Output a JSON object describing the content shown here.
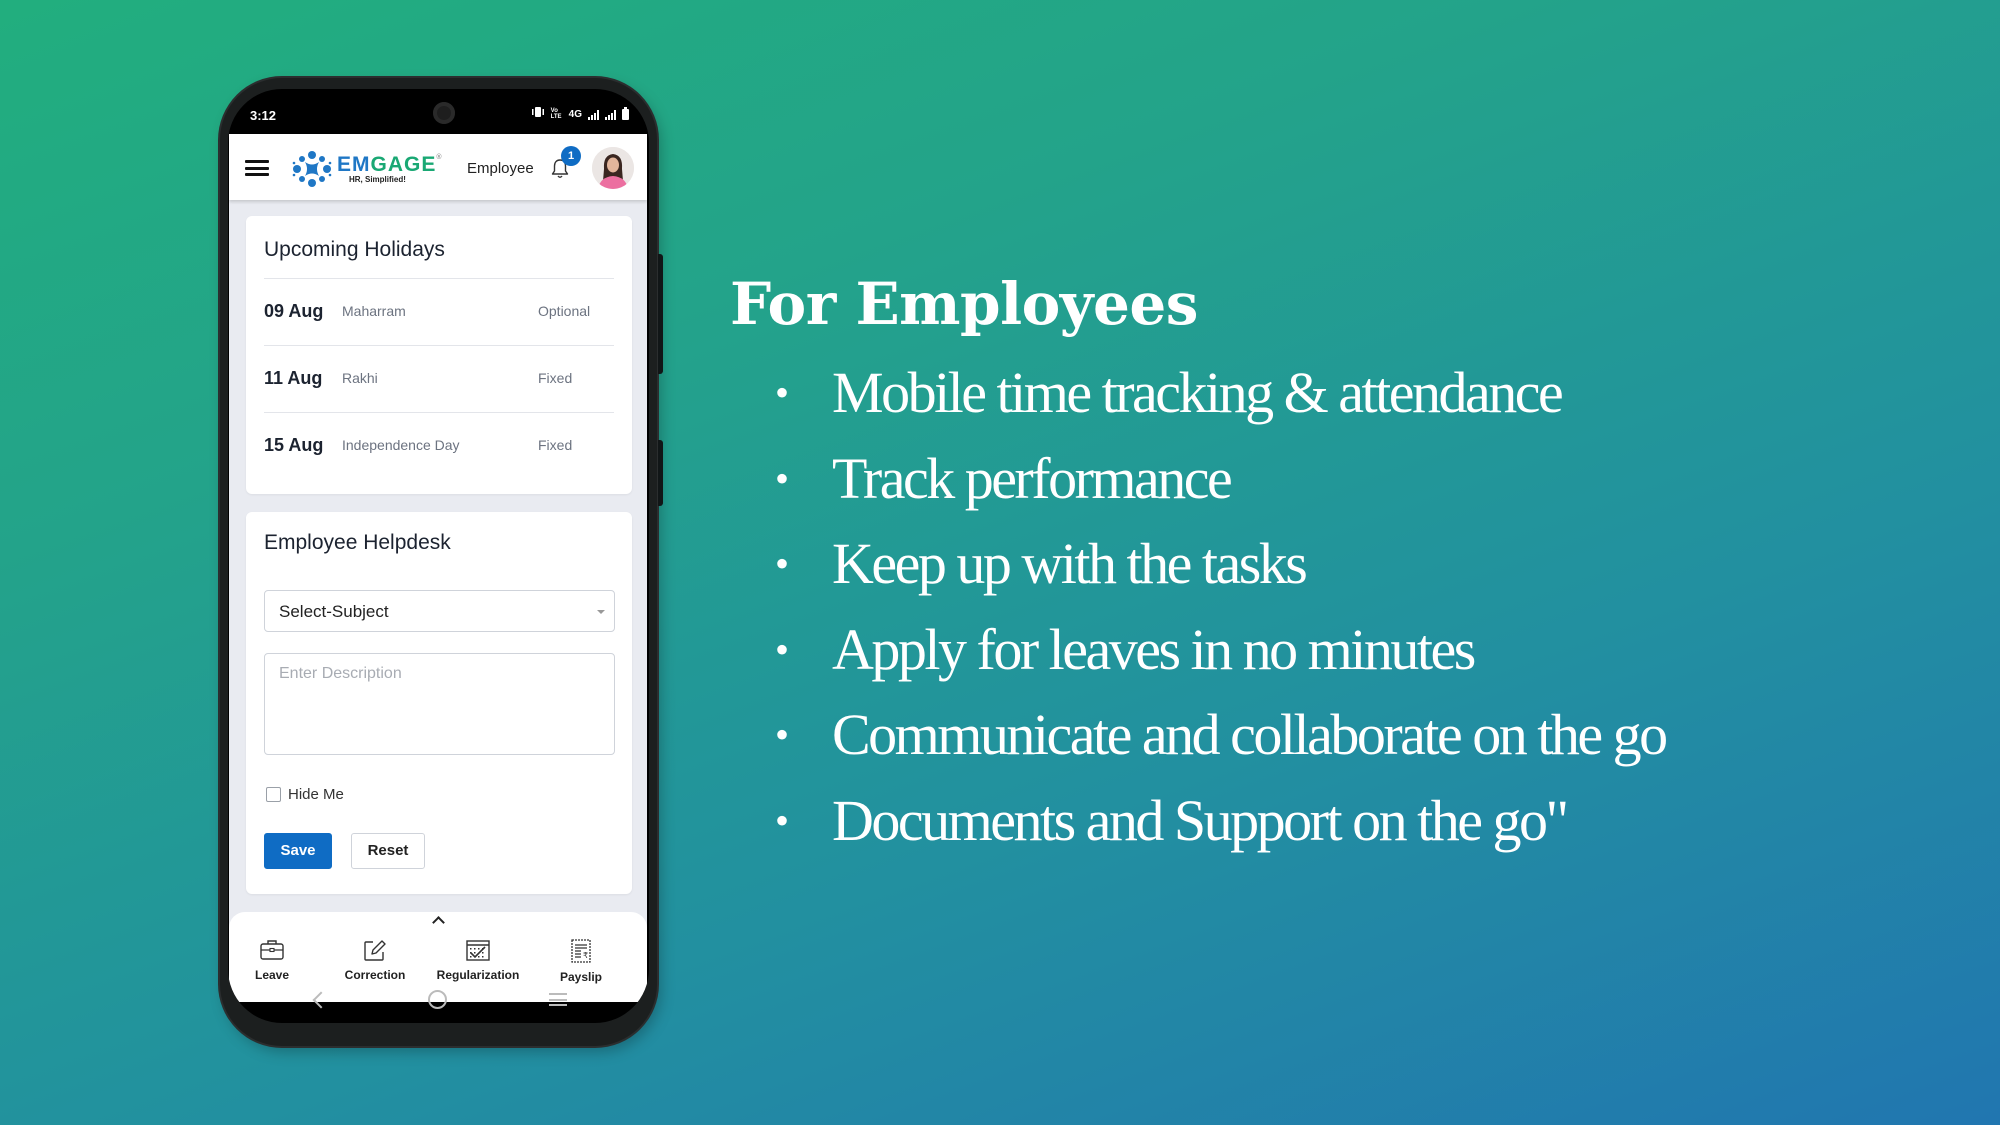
{
  "status_bar": {
    "time": "3:12",
    "network_label": "4G",
    "volte_label": "VoLTE"
  },
  "app_header": {
    "menu_icon": "hamburger-icon",
    "logo": {
      "word_part1": "EM",
      "word_part2": "GAGE",
      "registered": "®",
      "tagline": "HR, Simplified!"
    },
    "role": "Employee",
    "notifications_count": "1",
    "avatar_alt": "user-avatar"
  },
  "holidays": {
    "title": "Upcoming Holidays",
    "items": [
      {
        "date": "09 Aug",
        "name": "Maharram",
        "type": "Optional"
      },
      {
        "date": "11 Aug",
        "name": "Rakhi",
        "type": "Fixed"
      },
      {
        "date": "15 Aug",
        "name": "Independence Day",
        "type": "Fixed"
      }
    ]
  },
  "helpdesk": {
    "title": "Employee Helpdesk",
    "subject_select": {
      "selected": "Select-Subject"
    },
    "description": {
      "value": "",
      "placeholder": "Enter Description"
    },
    "hide_me": {
      "label": "Hide Me",
      "checked": false
    },
    "save_label": "Save",
    "reset_label": "Reset"
  },
  "bottom_nav": {
    "items": [
      {
        "label": "Leave",
        "icon": "briefcase-icon"
      },
      {
        "label": "Correction",
        "icon": "edit-icon"
      },
      {
        "label": "Regularization",
        "icon": "calendar-check-icon"
      },
      {
        "label": "Payslip",
        "icon": "payslip-icon"
      }
    ]
  },
  "promo": {
    "title": "For Employees",
    "bullets": [
      "Mobile time tracking & attendance",
      "Track performance",
      "Keep up with the tasks",
      "Apply for leaves in no minutes",
      "Communicate and collaborate on the go",
      "Documents and Support on the go\""
    ]
  },
  "colors": {
    "background_start": "#22AE7E",
    "background_end": "#2176B0",
    "primary_button": "#0F6CC4",
    "logo_blue": "#1F77C5",
    "logo_green": "#1AA874"
  }
}
